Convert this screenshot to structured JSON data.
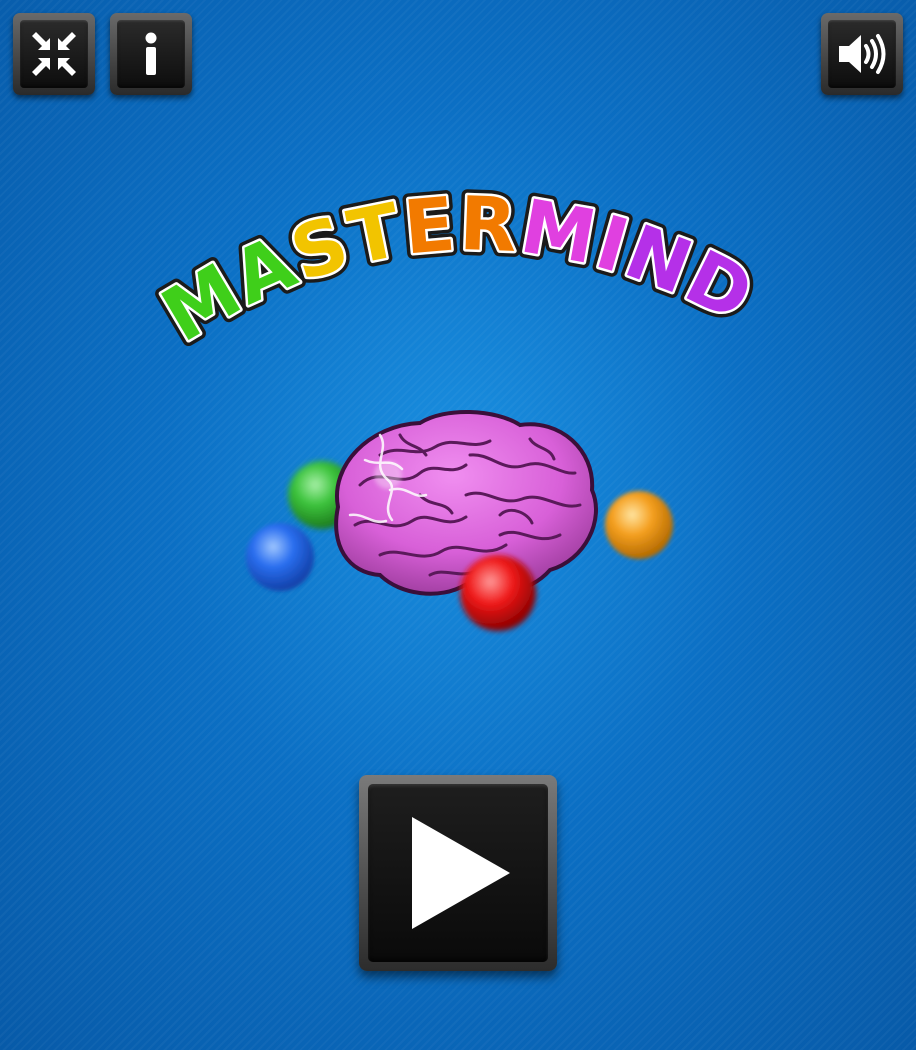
{
  "title": "MASTERMIND",
  "title_letter_colors": [
    "#3fcf1a",
    "#3fcf1a",
    "#f2c400",
    "#f2c400",
    "#f27a00",
    "#f27a00",
    "#e040e0",
    "#e040e0",
    "#b530e8",
    "#b530e8"
  ],
  "toolbar": {
    "fullscreen_icon": "collapse-arrows-icon",
    "info_icon": "info-icon",
    "sound_icon": "speaker-icon"
  },
  "hero": {
    "brain_color": "#d860d8",
    "orbs": [
      {
        "name": "blue-orb",
        "color": "#2a6ff0"
      },
      {
        "name": "green-orb",
        "color": "#3cc43c"
      },
      {
        "name": "red-orb",
        "color": "#f01818"
      },
      {
        "name": "orange-orb",
        "color": "#f5a020"
      }
    ]
  },
  "play_icon": "play-icon",
  "colors": {
    "background": "#0b6fc4",
    "button_dark": "#111111",
    "button_rim": "#555555"
  }
}
